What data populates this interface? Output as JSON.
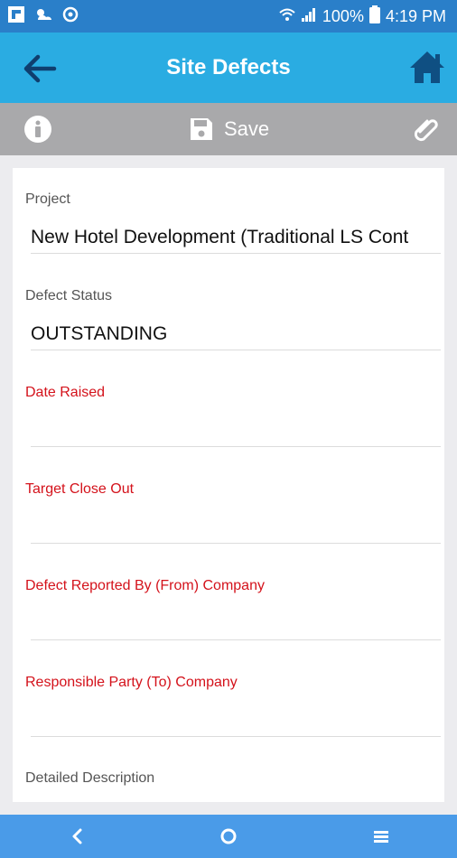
{
  "status": {
    "battery": "100%",
    "time": "4:19 PM",
    "icons": [
      "flipboard-icon",
      "weather-icon",
      "sync-icon",
      "wifi-icon",
      "signal-icon",
      "battery-icon"
    ]
  },
  "app_bar": {
    "title": "Site Defects",
    "icons": [
      "back-arrow-icon",
      "home-icon"
    ]
  },
  "toolbar": {
    "save_label": "Save",
    "icons": [
      "info-icon",
      "save-icon",
      "paperclip-icon"
    ]
  },
  "form": {
    "fields": [
      {
        "label": "Project",
        "value": "New Hotel Development (Traditional LS Cont",
        "required": false
      },
      {
        "label": "Defect Status",
        "value": "OUTSTANDING",
        "required": false
      },
      {
        "label": "Date Raised",
        "value": "",
        "required": true
      },
      {
        "label": "Target Close Out",
        "value": "",
        "required": true
      },
      {
        "label": "Defect Reported By (From) Company",
        "value": "",
        "required": true
      },
      {
        "label": "Responsible Party (To) Company",
        "value": "",
        "required": true
      },
      {
        "label": "Detailed Description",
        "value": "",
        "required": false
      }
    ]
  },
  "nav_bar": {
    "icons": [
      "nav-back-icon",
      "nav-home-icon",
      "nav-recents-icon"
    ]
  },
  "colors": {
    "status_bar": "#2a7fc9",
    "app_bar": "#2aace2",
    "toolbar": "#a9a9ab",
    "required_label": "#d4121b",
    "nav_bar": "#4a9be8"
  }
}
